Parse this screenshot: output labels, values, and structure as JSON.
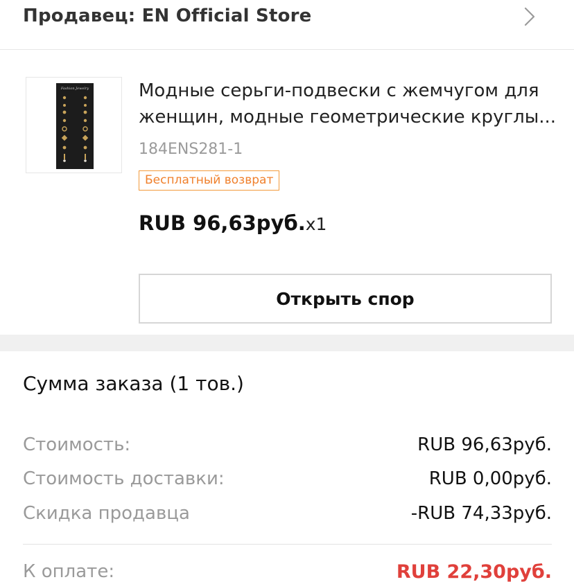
{
  "seller": {
    "title": "Продавец: EN Official Store",
    "chevron_icon": "chevron-right-icon"
  },
  "product": {
    "title_line1": "Модные серьги-подвески с жемчугом для",
    "title_line2": "женщин, модные геометрические круглы...",
    "sku": "184ENS281-1",
    "return_badge": "Бесплатный возврат",
    "price": "RUB 96,63руб.",
    "quantity": "x1",
    "dispute_button": "Открыть спор",
    "thumbnail_icon": "earrings-card-image"
  },
  "summary": {
    "title": "Сумма заказа (1 тов.)",
    "rows": [
      {
        "label": "Стоимость:",
        "value": "RUB 96,63руб."
      },
      {
        "label": "Стоимость доставки:",
        "value": "RUB 0,00руб."
      },
      {
        "label": "Скидка продавца",
        "value": "-RUB 74,33руб."
      }
    ],
    "total_label": "К оплате:",
    "total_value": "RUB 22,30руб."
  },
  "colors": {
    "accent_orange": "#f0802c",
    "total_red": "#e0403b",
    "muted_gray": "#9a9a9a"
  }
}
